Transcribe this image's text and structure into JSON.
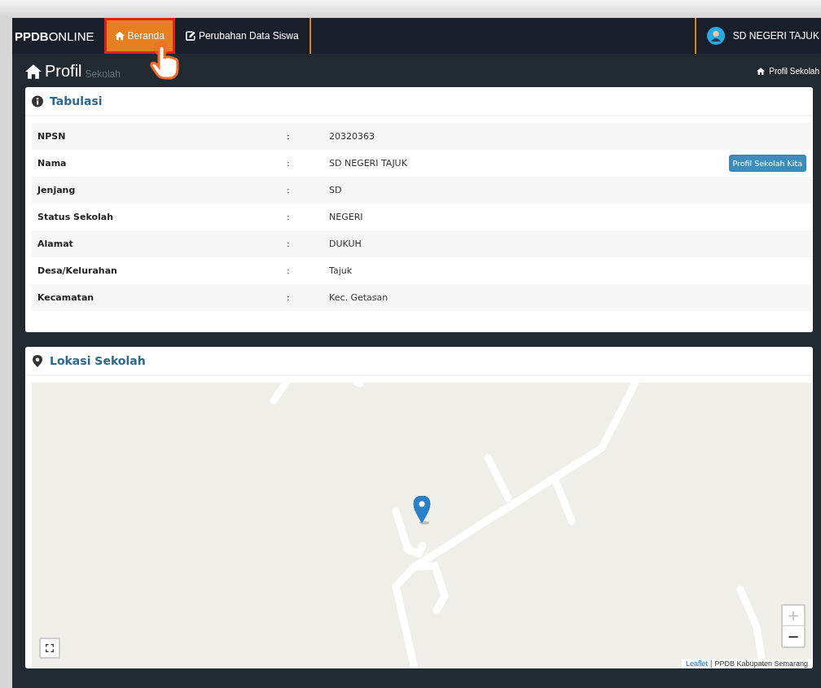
{
  "navbar": {
    "brand_bold": "PPDB",
    "brand_light": "ONLINE",
    "items": [
      {
        "label": "Beranda",
        "kind": "home",
        "selected": true
      },
      {
        "label": "Perubahan Data Siswa",
        "kind": "edit",
        "selected": false
      }
    ],
    "user": "SD NEGERI TAJUK"
  },
  "page_header": {
    "title": "Profil",
    "subtitle": "Sekolah",
    "breadcrumb": "Profil Sekolah"
  },
  "tabulasi": {
    "title": "Tabulasi",
    "rows": [
      {
        "label": "NPSN",
        "separator": ":",
        "value": "20320363"
      },
      {
        "label": "Nama",
        "separator": ":",
        "value": "SD NEGERI TAJUK",
        "button": "Profil Sekolah Kita"
      },
      {
        "label": "Jenjang",
        "separator": ":",
        "value": "SD"
      },
      {
        "label": "Status Sekolah",
        "separator": ":",
        "value": "NEGERI"
      },
      {
        "label": "Alamat",
        "separator": ":",
        "value": "DUKUH"
      },
      {
        "label": "Desa/Kelurahan",
        "separator": ":",
        "value": "Tajuk"
      },
      {
        "label": "Kecamatan",
        "separator": ":",
        "value": "Kec. Getasan"
      }
    ]
  },
  "lokasi": {
    "title": "Lokasi Sekolah",
    "map": {
      "kind": "picture",
      "zoom_in": "+",
      "zoom_out": "−",
      "attribution_link": "Leaflet",
      "attribution_separator": "|",
      "attribution_text": "PPDB Kabupaten Semarang"
    }
  }
}
